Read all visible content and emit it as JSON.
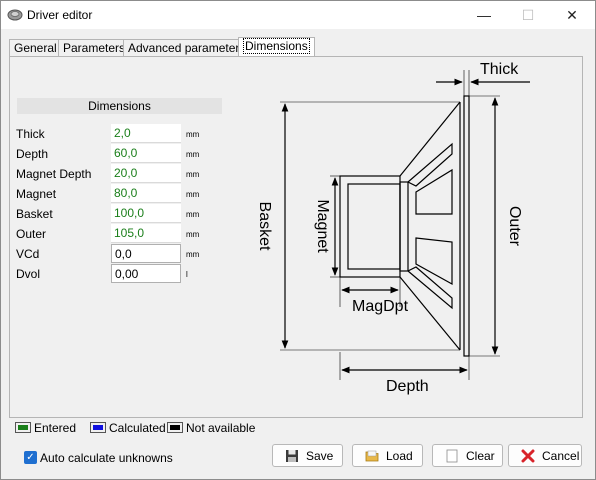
{
  "window": {
    "title": "Driver editor",
    "minimize": "—",
    "maximize": "☐",
    "close": "✕"
  },
  "tabs": [
    {
      "label": "General"
    },
    {
      "label": "Parameters"
    },
    {
      "label": "Advanced parameters"
    },
    {
      "label": "Dimensions"
    }
  ],
  "dimensions": {
    "header": "Dimensions",
    "rows": [
      {
        "label": "Thick",
        "value": "2,0",
        "unit": "mm"
      },
      {
        "label": "Depth",
        "value": "60,0",
        "unit": "mm"
      },
      {
        "label": "Magnet Depth",
        "value": "20,0",
        "unit": "mm"
      },
      {
        "label": "Magnet",
        "value": "80,0",
        "unit": "mm"
      },
      {
        "label": "Basket",
        "value": "100,0",
        "unit": "mm"
      },
      {
        "label": "Outer",
        "value": "105,0",
        "unit": "mm"
      },
      {
        "label": "VCd",
        "value": "0,0",
        "unit": "mm"
      },
      {
        "label": "Dvol",
        "value": "0,00",
        "unit": "l"
      }
    ]
  },
  "diagram": {
    "thick": "Thick",
    "basket": "Basket",
    "magnet": "Magnet",
    "outer": "Outer",
    "magdpt": "MagDpt",
    "depth": "Depth"
  },
  "legend": [
    {
      "label": "Entered",
      "color": "#1a7f1a"
    },
    {
      "label": "Calculated",
      "color": "#1010e0"
    },
    {
      "label": "Not available",
      "color": "#000000"
    }
  ],
  "auto_calc": {
    "label": "Auto calculate unknowns",
    "checked": true
  },
  "buttons": {
    "save": "Save",
    "load": "Load",
    "clear": "Clear",
    "cancel": "Cancel"
  }
}
